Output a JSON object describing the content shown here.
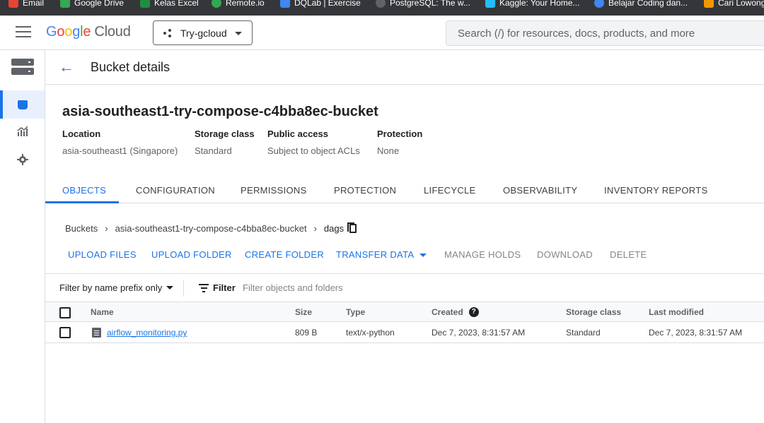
{
  "bookmarks": [
    {
      "label": "Email",
      "color": "#ea4335"
    },
    {
      "label": "Google Drive",
      "color": "#34a853"
    },
    {
      "label": "Kelas Excel",
      "color": "#1e8e3e"
    },
    {
      "label": "Remote.io",
      "color": "#34a853"
    },
    {
      "label": "DQLab | Exercise",
      "color": "#4285f4"
    },
    {
      "label": "PostgreSQL: The w...",
      "color": "#5f6368"
    },
    {
      "label": "Kaggle: Your Home...",
      "color": "#20beff"
    },
    {
      "label": "Belajar Coding dan...",
      "color": "#4285f4"
    },
    {
      "label": "Cari Lowong",
      "color": "#f29900"
    }
  ],
  "topbar": {
    "logo_google": [
      "G",
      "o",
      "o",
      "g",
      "l",
      "e"
    ],
    "logo_cloud": "Cloud",
    "project": "Try-gcloud",
    "search_placeholder": "Search (/) for resources, docs, products, and more"
  },
  "header": {
    "back": "←",
    "title": "Bucket details"
  },
  "bucket": {
    "name": "asia-southeast1-try-compose-c4bba8ec-bucket",
    "meta": [
      {
        "label": "Location",
        "value": "asia-southeast1 (Singapore)"
      },
      {
        "label": "Storage class",
        "value": "Standard"
      },
      {
        "label": "Public access",
        "value": "Subject to object ACLs"
      },
      {
        "label": "Protection",
        "value": "None"
      }
    ]
  },
  "tabs": [
    "OBJECTS",
    "CONFIGURATION",
    "PERMISSIONS",
    "PROTECTION",
    "LIFECYCLE",
    "OBSERVABILITY",
    "INVENTORY REPORTS"
  ],
  "breadcrumb": {
    "items": [
      "Buckets",
      "asia-southeast1-try-compose-c4bba8ec-bucket",
      "dags"
    ],
    "sep": "›"
  },
  "actions": {
    "upload_files": "UPLOAD FILES",
    "upload_folder": "UPLOAD FOLDER",
    "create_folder": "CREATE FOLDER",
    "transfer_data": "TRANSFER DATA",
    "manage_holds": "MANAGE HOLDS",
    "download": "DOWNLOAD",
    "delete": "DELETE"
  },
  "filter": {
    "prefix_mode": "Filter by name prefix only",
    "label": "Filter",
    "placeholder": "Filter objects and folders"
  },
  "table": {
    "columns": [
      "Name",
      "Size",
      "Type",
      "Created",
      "Storage class",
      "Last modified"
    ],
    "help": "?",
    "rows": [
      {
        "name": "airflow_monitoring.py",
        "size": "809 B",
        "type": "text/x-python",
        "created": "Dec 7, 2023, 8:31:57 AM",
        "storage_class": "Standard",
        "last_modified": "Dec 7, 2023, 8:31:57 AM"
      }
    ]
  },
  "colors": {
    "accent": "#1a73e8",
    "border": "#dadce0",
    "muted": "#5f6368"
  }
}
